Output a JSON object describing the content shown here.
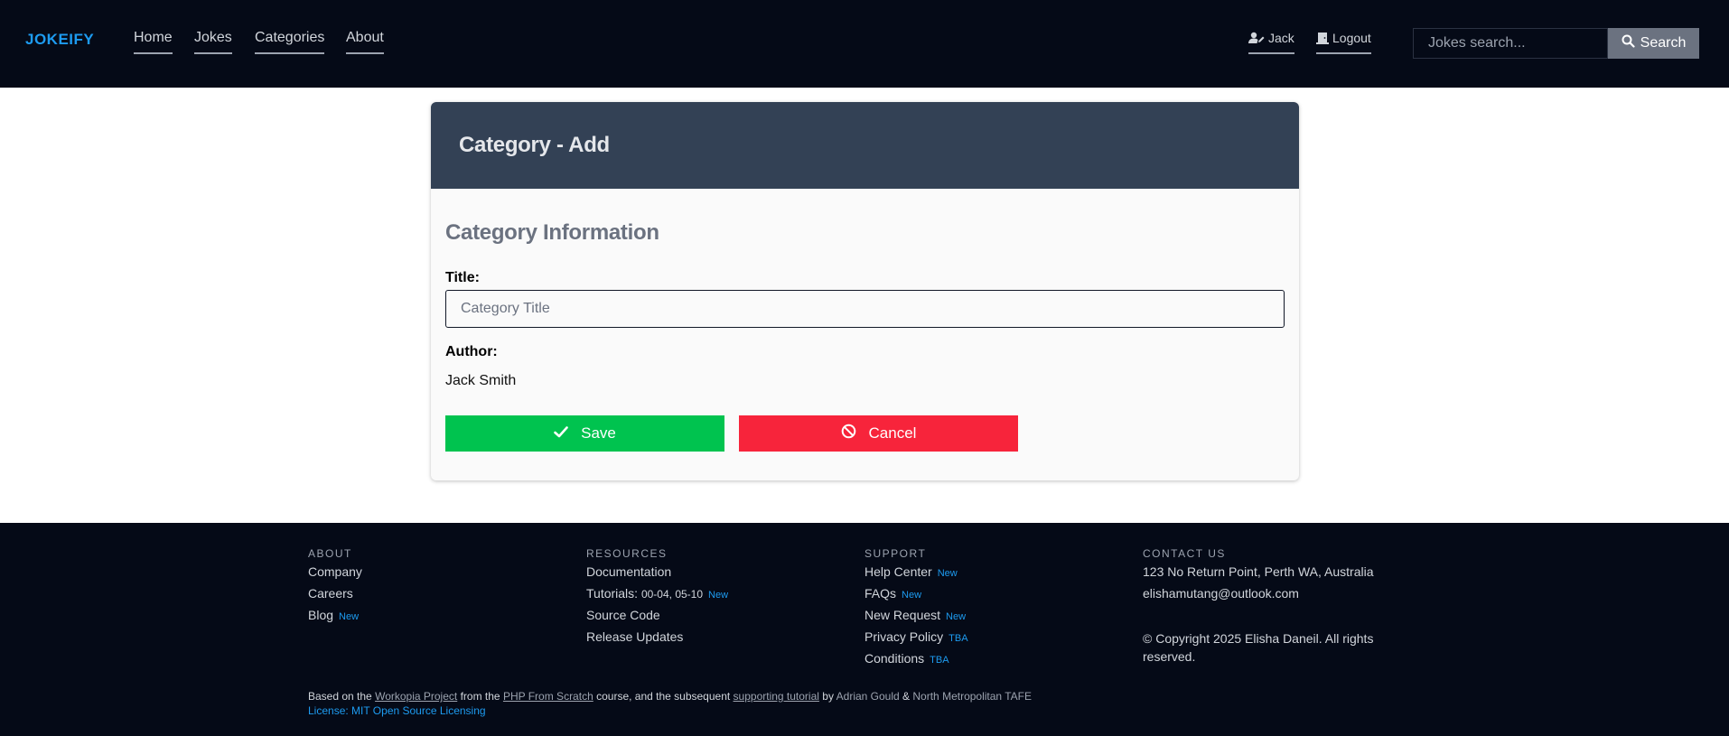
{
  "navbar": {
    "brand": "JOKEIFY",
    "links": [
      {
        "label": "Home"
      },
      {
        "label": "Jokes"
      },
      {
        "label": "Categories"
      },
      {
        "label": "About"
      }
    ],
    "user_label": "Jack",
    "logout_label": "Logout",
    "search_placeholder": "Jokes search...",
    "search_button_label": "Search"
  },
  "card": {
    "header_title": "Category - Add",
    "section_title": "Category Information",
    "title_label": "Title:",
    "title_placeholder": "Category Title",
    "title_value": "",
    "author_label": "Author:",
    "author_value": "Jack Smith",
    "save_label": "Save",
    "cancel_label": "Cancel"
  },
  "footer": {
    "about": {
      "heading": "ABOUT",
      "items": [
        "Company",
        "Careers",
        "Blog"
      ],
      "blog_badge": "New"
    },
    "resources": {
      "heading": "RESOURCES",
      "documentation": "Documentation",
      "tutorials_label": "Tutorials:",
      "tutorials_value": "00-04, 05-10",
      "tutorials_badge": "New",
      "source_code": "Source Code",
      "release_updates": "Release Updates"
    },
    "support": {
      "heading": "SUPPORT",
      "help_center": "Help Center",
      "help_center_badge": "New",
      "faqs": "FAQs",
      "faqs_badge": "New",
      "new_request": "New Request",
      "new_request_badge": "New",
      "privacy_policy": "Privacy Policy",
      "privacy_policy_badge": "TBA",
      "conditions": "Conditions",
      "conditions_badge": "TBA"
    },
    "contact": {
      "heading": "CONTACT US",
      "address": "123 No Return Point, Perth WA, Australia",
      "email": "elishamutang@outlook.com",
      "copyright": "© Copyright 2025 Elisha Daneil. All rights reserved."
    },
    "credits": {
      "based_on": "Based on the",
      "workopia_link": "Workopia Project",
      "from_the": "from the",
      "php_link": "PHP From Scratch",
      "course_text": "course, and the subsequent",
      "tutorial_link": "supporting tutorial",
      "by": "by",
      "author": "Adrian Gould",
      "amp": "&",
      "institution": "North Metropolitan TAFE",
      "license": "License: MIT Open Source Licensing"
    }
  },
  "colors": {
    "navbar_bg": "#050a17",
    "brand": "#1d9bf0",
    "card_header_bg": "#334155",
    "save_button": "#00c34f",
    "cancel_button": "#f7243b",
    "badge": "#1d9bf0"
  },
  "icons": {
    "user": "user-pen-icon",
    "logout": "door-icon",
    "search": "magnifier-icon",
    "save": "check-icon",
    "cancel": "ban-icon"
  }
}
